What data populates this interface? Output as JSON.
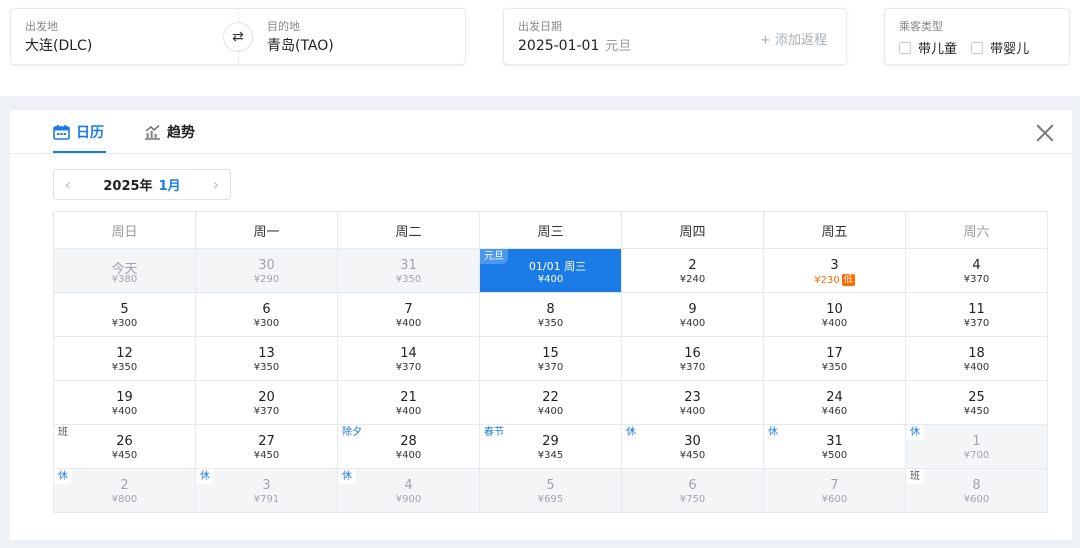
{
  "search": {
    "from_label": "出发地",
    "from_value": "大连(DLC)",
    "to_label": "目的地",
    "to_value": "青岛(TAO)",
    "date_label": "出发日期",
    "date_value": "2025-01-01",
    "date_holiday": "元旦",
    "add_return": "+ 添加返程",
    "passenger_label": "乘客类型",
    "child_label": "带儿童",
    "infant_label": "带婴儿"
  },
  "tabs": [
    {
      "label": "日历",
      "icon": "calendar-icon",
      "active": true
    },
    {
      "label": "趋势",
      "icon": "chart-icon",
      "active": false
    }
  ],
  "month_nav": {
    "year": "2025年",
    "month": "1月"
  },
  "weekdays": [
    "周日",
    "周一",
    "周二",
    "周三",
    "周四",
    "周五",
    "周六"
  ],
  "weeks": [
    [
      {
        "day": "今天",
        "price": "¥380",
        "muted": true
      },
      {
        "day": "30",
        "price": "¥290",
        "muted": true
      },
      {
        "day": "31",
        "price": "¥350",
        "muted": true
      },
      {
        "day": "01/01 周三",
        "price": "¥400",
        "tag": "元旦",
        "selected": true
      },
      {
        "day": "2",
        "price": "¥240"
      },
      {
        "day": "3",
        "price": "¥230",
        "low": true,
        "badge": "低"
      },
      {
        "day": "4",
        "price": "¥370"
      }
    ],
    [
      {
        "day": "5",
        "price": "¥300"
      },
      {
        "day": "6",
        "price": "¥300"
      },
      {
        "day": "7",
        "price": "¥400"
      },
      {
        "day": "8",
        "price": "¥350"
      },
      {
        "day": "9",
        "price": "¥400"
      },
      {
        "day": "10",
        "price": "¥400"
      },
      {
        "day": "11",
        "price": "¥370"
      }
    ],
    [
      {
        "day": "12",
        "price": "¥350"
      },
      {
        "day": "13",
        "price": "¥350"
      },
      {
        "day": "14",
        "price": "¥370"
      },
      {
        "day": "15",
        "price": "¥370"
      },
      {
        "day": "16",
        "price": "¥370"
      },
      {
        "day": "17",
        "price": "¥350"
      },
      {
        "day": "18",
        "price": "¥400"
      }
    ],
    [
      {
        "day": "19",
        "price": "¥400"
      },
      {
        "day": "20",
        "price": "¥370"
      },
      {
        "day": "21",
        "price": "¥400"
      },
      {
        "day": "22",
        "price": "¥400"
      },
      {
        "day": "23",
        "price": "¥400"
      },
      {
        "day": "24",
        "price": "¥460"
      },
      {
        "day": "25",
        "price": "¥450"
      }
    ],
    [
      {
        "day": "26",
        "price": "¥450",
        "tag": "班",
        "tagType": "ban"
      },
      {
        "day": "27",
        "price": "¥450"
      },
      {
        "day": "28",
        "price": "¥400",
        "tag": "除夕"
      },
      {
        "day": "29",
        "price": "¥345",
        "tag": "春节"
      },
      {
        "day": "30",
        "price": "¥450",
        "tag": "休"
      },
      {
        "day": "31",
        "price": "¥500",
        "tag": "休"
      },
      {
        "day": "1",
        "price": "¥700",
        "tag": "休",
        "muted": true
      }
    ],
    [
      {
        "day": "2",
        "price": "¥800",
        "tag": "休",
        "muted": true
      },
      {
        "day": "3",
        "price": "¥791",
        "tag": "休",
        "muted": true
      },
      {
        "day": "4",
        "price": "¥900",
        "tag": "休",
        "muted": true
      },
      {
        "day": "5",
        "price": "¥695",
        "muted": true
      },
      {
        "day": "6",
        "price": "¥750",
        "muted": true
      },
      {
        "day": "7",
        "price": "¥600",
        "muted": true
      },
      {
        "day": "8",
        "price": "¥600",
        "tag": "班",
        "tagType": "ban",
        "muted": true
      }
    ]
  ],
  "colors": {
    "accent": "#1a7be6",
    "low_price": "#ff6a00"
  }
}
